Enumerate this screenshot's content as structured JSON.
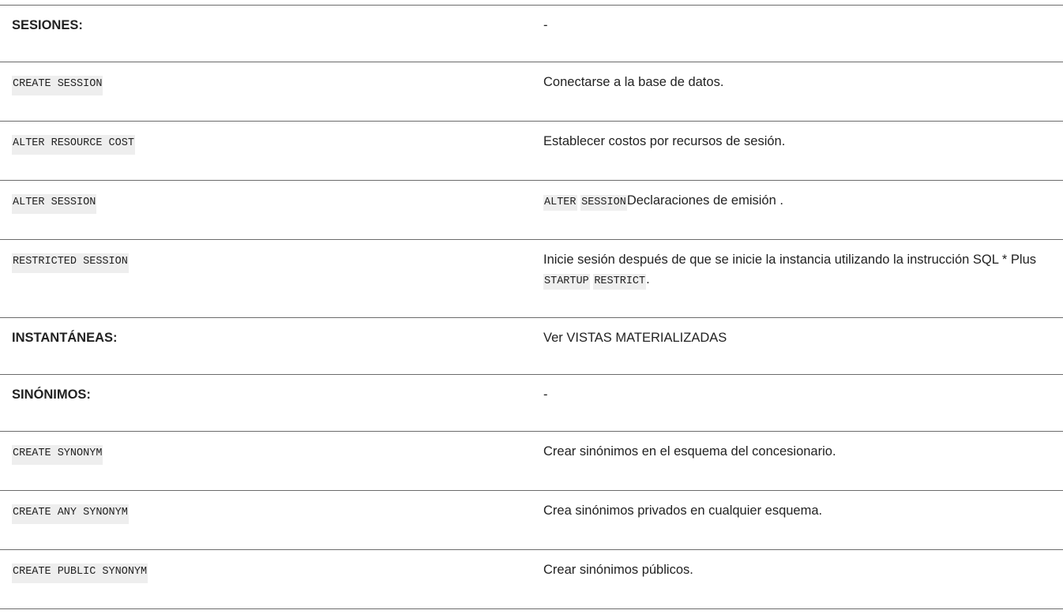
{
  "rows": [
    {
      "left": "SESIONES:",
      "right": "-"
    },
    {
      "left": "CREATE SESSION",
      "right": "Conectarse a la base de datos."
    },
    {
      "left": "ALTER RESOURCE COST",
      "right": "Establecer costos por recursos de sesión."
    },
    {
      "left": "ALTER SESSION",
      "right_code1": "ALTER",
      "right_code2": "SESSION",
      "right_text": "Declaraciones de emisión ."
    },
    {
      "left": "RESTRICTED SESSION",
      "right_text1": "Inicie sesión después de que se inicie la instancia utilizando la instrucción SQL * Plus ",
      "right_code1": "STARTUP",
      "right_code2": "RESTRICT",
      "right_text2": "."
    },
    {
      "left": "INSTANTÁNEAS:",
      "right": "Ver VISTAS MATERIALIZADAS"
    },
    {
      "left": "SINÓNIMOS:",
      "right": "-"
    },
    {
      "left": "CREATE SYNONYM",
      "right": "Crear sinónimos en el esquema del concesionario."
    },
    {
      "left": "CREATE ANY SYNONYM",
      "right": "Crea sinónimos privados en cualquier esquema."
    },
    {
      "left": "CREATE PUBLIC SYNONYM",
      "right": "Crear sinónimos públicos."
    }
  ]
}
